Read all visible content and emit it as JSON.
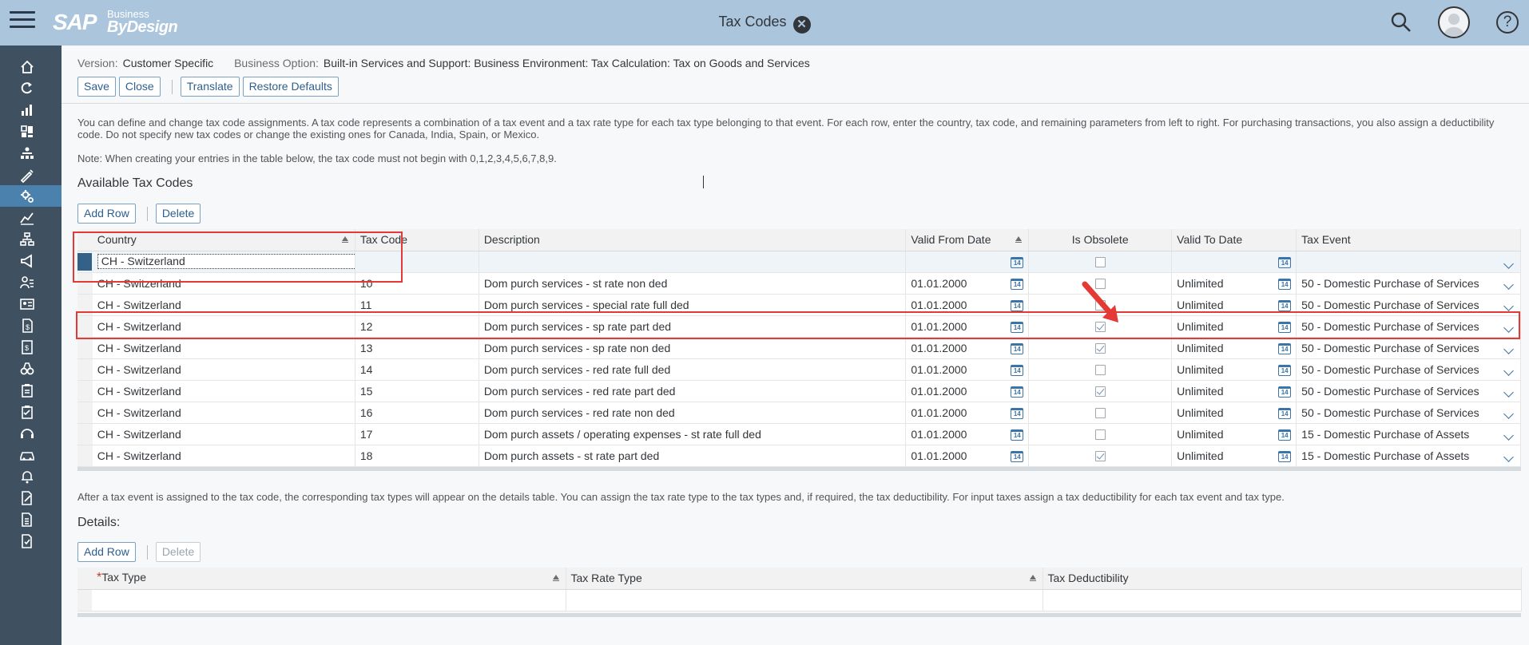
{
  "shell": {
    "title": "Tax Codes",
    "logo_sap": "SAP",
    "logo_business": "Business",
    "logo_bydesign": "ByDesign",
    "close_glyph": "✕",
    "help_glyph": "?"
  },
  "sidebar": {
    "items": [
      {
        "icon": "home-icon"
      },
      {
        "icon": "refresh-icon"
      },
      {
        "icon": "bar-chart-icon"
      },
      {
        "icon": "dashboard-icon"
      },
      {
        "icon": "org-icon"
      },
      {
        "icon": "edit-tools-icon"
      },
      {
        "icon": "settings-icon",
        "active": true
      },
      {
        "icon": "line-chart-icon"
      },
      {
        "icon": "hierarchy-icon"
      },
      {
        "icon": "megaphone-icon"
      },
      {
        "icon": "person-list-icon"
      },
      {
        "icon": "id-card-icon"
      },
      {
        "icon": "document-money-icon"
      },
      {
        "icon": "invoice-icon"
      },
      {
        "icon": "binoculars-icon"
      },
      {
        "icon": "clipboard-icon"
      },
      {
        "icon": "checklist-icon"
      },
      {
        "icon": "headset-icon"
      },
      {
        "icon": "car-icon"
      },
      {
        "icon": "bell-icon"
      },
      {
        "icon": "document-edit-icon"
      },
      {
        "icon": "document-icon"
      },
      {
        "icon": "expense-icon"
      }
    ]
  },
  "header": {
    "version_label": "Version:",
    "version_value": "Customer Specific",
    "option_label": "Business Option:",
    "option_value": "Built-in Services and Support: Business Environment: Tax Calculation: Tax on Goods and Services"
  },
  "toolbar": {
    "save": "Save",
    "close": "Close",
    "translate": "Translate",
    "restore": "Restore Defaults"
  },
  "info": {
    "description": "You can define and change tax code assignments. A tax code represents a combination of a tax event and a tax rate type for each tax type belonging to that event. For each row, enter the country, tax code, and remaining parameters from left to right. For purchasing transactions, you also assign a deductibility code. Do not specify new tax codes or change the existing ones for Canada, India, Spain, or Mexico.",
    "note": "Note: When creating your entries in the table below, the tax code must not begin with 0,1,2,3,4,5,6,7,8,9.",
    "details_hint": "After a tax event is assigned to the tax code, the corresponding tax types will appear on the details table. You can assign the tax rate type to the tax types and, if required, the tax deductibility. For input taxes assign a tax deductibility for each tax event and tax type."
  },
  "available": {
    "title": "Available Tax Codes",
    "add_row": "Add Row",
    "delete": "Delete",
    "columns": {
      "country": "Country",
      "tax_code": "Tax Code",
      "description": "Description",
      "valid_from": "Valid From Date",
      "is_obsolete": "Is Obsolete",
      "valid_to": "Valid To Date",
      "tax_event": "Tax Event"
    },
    "edit_row": {
      "country": "CH - Switzerland"
    },
    "cal_glyph": "14",
    "rows": [
      {
        "country": "CH - Switzerland",
        "code": "10",
        "desc": "Dom purch services - st rate non ded",
        "from": "01.01.2000",
        "obsolete": false,
        "to": "Unlimited",
        "event": "50 - Domestic Purchase of Services"
      },
      {
        "country": "CH - Switzerland",
        "code": "11",
        "desc": "Dom purch services - special rate full ded",
        "from": "01.01.2000",
        "obsolete": false,
        "to": "Unlimited",
        "event": "50 - Domestic Purchase of Services"
      },
      {
        "country": "CH - Switzerland",
        "code": "12",
        "desc": "Dom purch services - sp rate part ded",
        "from": "01.01.2000",
        "obsolete": true,
        "to": "Unlimited",
        "event": "50 - Domestic Purchase of Services"
      },
      {
        "country": "CH - Switzerland",
        "code": "13",
        "desc": "Dom purch services - sp rate non ded",
        "from": "01.01.2000",
        "obsolete": true,
        "to": "Unlimited",
        "event": "50 - Domestic Purchase of Services"
      },
      {
        "country": "CH - Switzerland",
        "code": "14",
        "desc": "Dom purch services - red rate full ded",
        "from": "01.01.2000",
        "obsolete": false,
        "to": "Unlimited",
        "event": "50 - Domestic Purchase of Services"
      },
      {
        "country": "CH - Switzerland",
        "code": "15",
        "desc": "Dom purch services - red rate part ded",
        "from": "01.01.2000",
        "obsolete": true,
        "to": "Unlimited",
        "event": "50 - Domestic Purchase of Services"
      },
      {
        "country": "CH - Switzerland",
        "code": "16",
        "desc": "Dom purch services - red rate non ded",
        "from": "01.01.2000",
        "obsolete": false,
        "to": "Unlimited",
        "event": "50 - Domestic Purchase of Services"
      },
      {
        "country": "CH - Switzerland",
        "code": "17",
        "desc": "Dom purch assets / operating expenses - st rate full ded",
        "from": "01.01.2000",
        "obsolete": false,
        "to": "Unlimited",
        "event": "15 - Domestic Purchase of Assets"
      },
      {
        "country": "CH - Switzerland",
        "code": "18",
        "desc": "Dom purch assets - st rate part ded",
        "from": "01.01.2000",
        "obsolete": true,
        "to": "Unlimited",
        "event": "15 - Domestic Purchase of Assets"
      }
    ]
  },
  "details": {
    "title": "Details:",
    "add_row": "Add Row",
    "delete": "Delete",
    "required_mark": "*",
    "columns": {
      "tax_type": "Tax Type",
      "tax_rate_type": "Tax Rate Type",
      "tax_deductibility": "Tax Deductibility"
    }
  },
  "colors": {
    "shell_bg": "#abc5dd",
    "sidebar_bg": "#3f5161",
    "sidebar_active": "#4b81ad",
    "highlight_red": "#e53935"
  }
}
